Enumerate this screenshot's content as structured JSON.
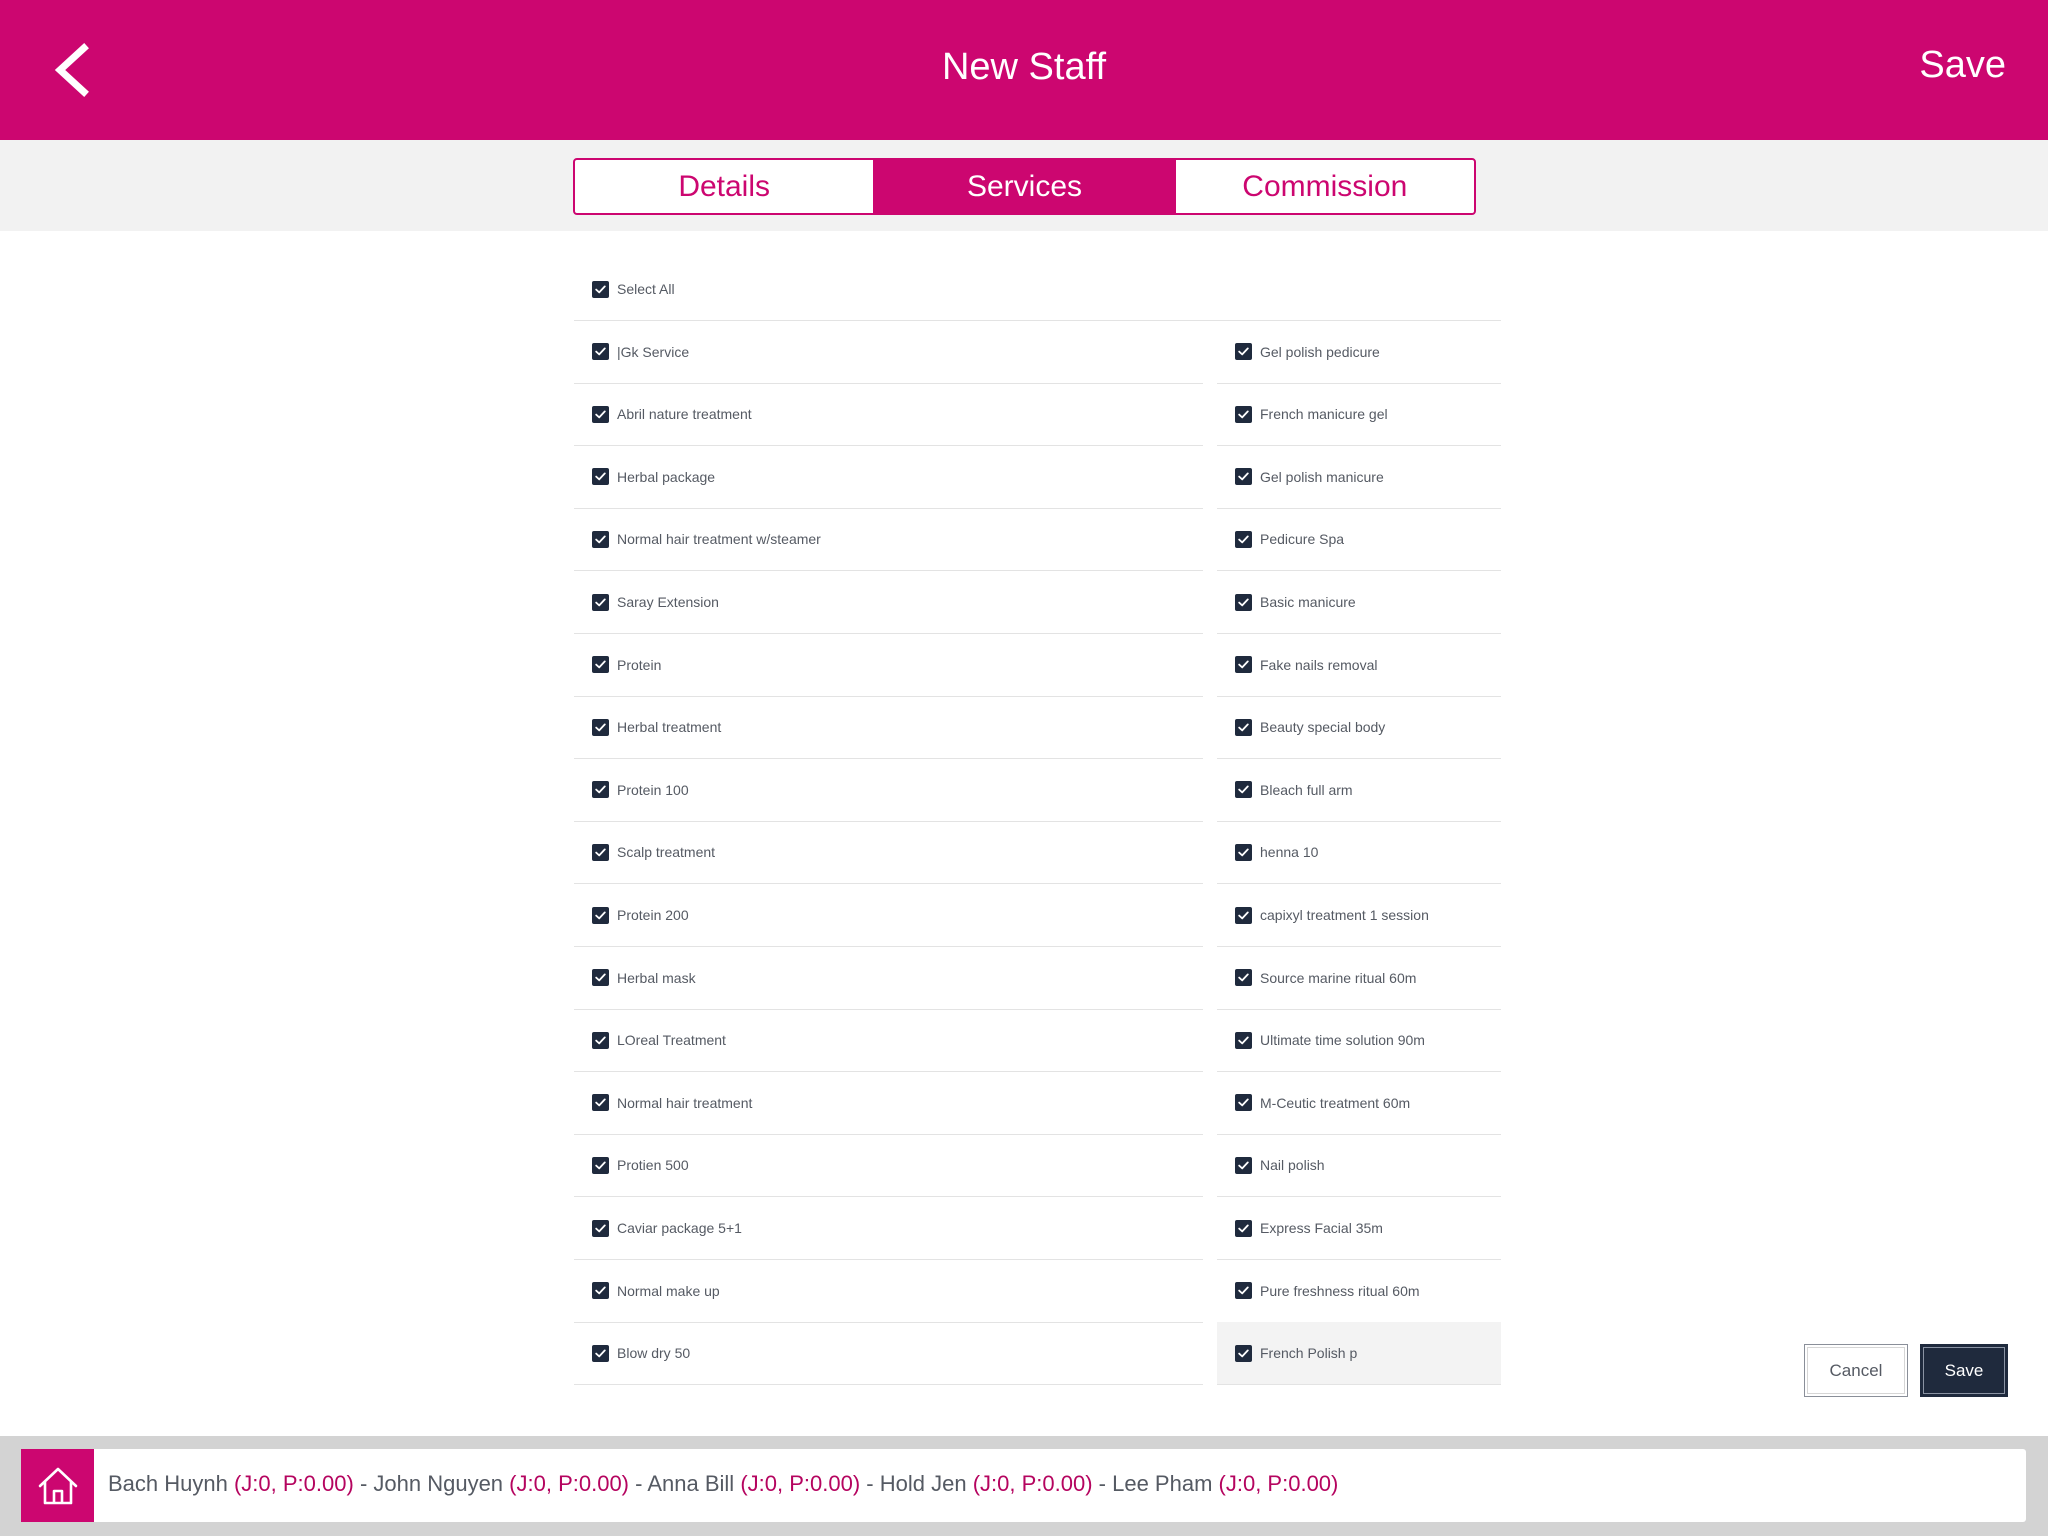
{
  "header": {
    "title": "New Staff",
    "save_label": "Save",
    "back_icon": "chevron-left-icon"
  },
  "tabs": [
    {
      "label": "Details",
      "active": false
    },
    {
      "label": "Services",
      "active": true
    },
    {
      "label": "Commission",
      "active": false
    }
  ],
  "services": {
    "select_all_label": "Select All",
    "left": [
      "|Gk Service",
      "Abril nature treatment",
      "Herbal package",
      "Normal hair treatment w/steamer",
      "Saray Extension",
      "Protein",
      "Herbal treatment",
      "Protein 100",
      "Scalp treatment",
      "Protein 200",
      "Herbal mask",
      "LOreal Treatment",
      "Normal hair treatment",
      "Protien 500",
      "Caviar package 5+1",
      "Normal make up",
      "Blow dry 50"
    ],
    "right": [
      "Gel polish pedicure",
      "French manicure gel",
      "Gel polish manicure",
      "Pedicure Spa",
      "Basic manicure",
      "Fake nails removal",
      "Beauty special body",
      "Bleach full arm",
      "henna 10",
      "capixyl treatment 1 session",
      "Source marine ritual 60m",
      "Ultimate time solution 90m",
      "M-Ceutic treatment 60m",
      "Nail polish",
      "Express Facial 35m",
      "Pure freshness ritual 60m",
      "French Polish p"
    ]
  },
  "actions": {
    "cancel_label": "Cancel",
    "save_label": "Save"
  },
  "footer": {
    "home_icon": "home-icon",
    "staff": [
      {
        "name": "Bach Huynh",
        "stats": "(J:0, P:0.00)"
      },
      {
        "name": "John Nguyen",
        "stats": "(J:0, P:0.00)"
      },
      {
        "name": "Anna Bill",
        "stats": "(J:0, P:0.00)"
      },
      {
        "name": "Hold Jen",
        "stats": "(J:0, P:0.00)"
      },
      {
        "name": "Lee Pham",
        "stats": "(J:0, P:0.00)"
      }
    ],
    "separator": " - "
  },
  "colors": {
    "brand": "#cc0670",
    "checkbox": "#1f2a3d",
    "text": "#555a63",
    "footer_bg": "#d3d3d3"
  }
}
